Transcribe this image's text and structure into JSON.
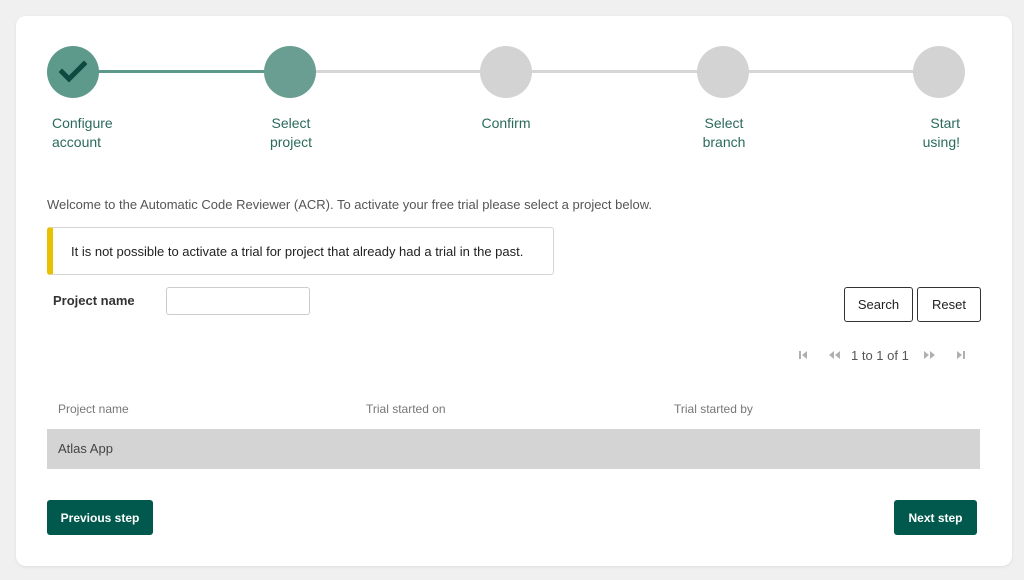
{
  "stepper": {
    "steps": [
      {
        "label": "Configure\naccount",
        "state": "done"
      },
      {
        "label": "Select\nproject",
        "state": "active"
      },
      {
        "label": "Confirm",
        "state": "todo"
      },
      {
        "label": "Select\nbranch",
        "state": "todo"
      },
      {
        "label": "Start\nusing!",
        "state": "todo"
      }
    ]
  },
  "intro": {
    "text": "Welcome to the Automatic Code Reviewer (ACR). To activate your free trial please select a project below."
  },
  "notice": {
    "text": "It is not possible to activate a trial for project that already had a trial in the past."
  },
  "filter": {
    "label": "Project name",
    "value": "",
    "search_label": "Search",
    "reset_label": "Reset"
  },
  "pagination": {
    "text": "1 to 1 of 1"
  },
  "table": {
    "columns": [
      "Project name",
      "Trial started on",
      "Trial started by"
    ],
    "rows": [
      [
        "Atlas App",
        "",
        ""
      ]
    ]
  },
  "footer": {
    "previous_label": "Previous step",
    "next_label": "Next step"
  },
  "colors": {
    "accent": "#00594c",
    "step_done": "#5e9a8c",
    "step_todo": "#d3d3d3",
    "notice_bar": "#e8c200",
    "selected_row": "#d4d4d4"
  }
}
